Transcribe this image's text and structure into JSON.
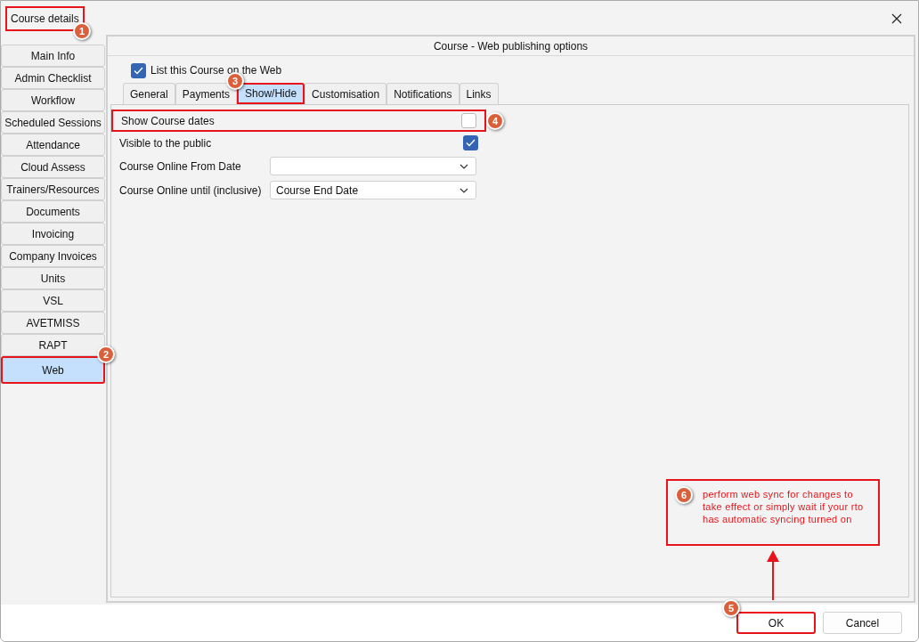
{
  "window": {
    "title": "Course details",
    "title_highlighted": true,
    "title_badge": "1"
  },
  "sidebar": {
    "items": [
      {
        "label": "Main Info",
        "selected": false,
        "highlighted": false
      },
      {
        "label": "Admin Checklist",
        "selected": false,
        "highlighted": false
      },
      {
        "label": "Workflow",
        "selected": false,
        "highlighted": false
      },
      {
        "label": "Scheduled Sessions",
        "selected": false,
        "highlighted": false
      },
      {
        "label": "Attendance",
        "selected": false,
        "highlighted": false
      },
      {
        "label": "Cloud Assess",
        "selected": false,
        "highlighted": false
      },
      {
        "label": "Trainers/Resources",
        "selected": false,
        "highlighted": false
      },
      {
        "label": "Documents",
        "selected": false,
        "highlighted": false
      },
      {
        "label": "Invoicing",
        "selected": false,
        "highlighted": false
      },
      {
        "label": "Company Invoices",
        "selected": false,
        "highlighted": false
      },
      {
        "label": "Units",
        "selected": false,
        "highlighted": false
      },
      {
        "label": "VSL",
        "selected": false,
        "highlighted": false
      },
      {
        "label": "AVETMISS",
        "selected": false,
        "highlighted": false
      },
      {
        "label": "RAPT",
        "selected": false,
        "highlighted": false
      },
      {
        "label": "Web",
        "selected": true,
        "highlighted": true,
        "badge": "2"
      }
    ]
  },
  "panel": {
    "title": "Course - Web publishing options",
    "list_on_web": {
      "label": "List this Course on the Web",
      "checked": true
    },
    "tabs": [
      {
        "label": "General",
        "selected": false,
        "highlighted": false
      },
      {
        "label": "Payments",
        "selected": false,
        "highlighted": false
      },
      {
        "label": "Show/Hide",
        "selected": true,
        "highlighted": true,
        "badge": "3"
      },
      {
        "label": "Customisation",
        "selected": false,
        "highlighted": false
      },
      {
        "label": "Notifications",
        "selected": false,
        "highlighted": false
      },
      {
        "label": "Links",
        "selected": false,
        "highlighted": false
      }
    ],
    "fields": [
      {
        "kind": "checkbox",
        "label": "Show Course dates",
        "checked": false,
        "highlighted": true,
        "badge": "4"
      },
      {
        "kind": "checkbox",
        "label": "Visible to the public",
        "checked": true,
        "highlighted": false
      },
      {
        "kind": "dropdown",
        "label": "Course Online From Date",
        "highlighted": false
      },
      {
        "kind": "dropdown",
        "label": "Course Online until (inclusive)",
        "value": "Course End Date",
        "highlighted": false
      }
    ]
  },
  "note": {
    "badge": "6",
    "text": "perform web sync for changes to take effect or simply wait if your rto has automatic syncing turned on"
  },
  "buttons": [
    {
      "label": "OK",
      "highlighted": true,
      "badge": "5"
    },
    {
      "label": "Cancel",
      "highlighted": false
    }
  ]
}
